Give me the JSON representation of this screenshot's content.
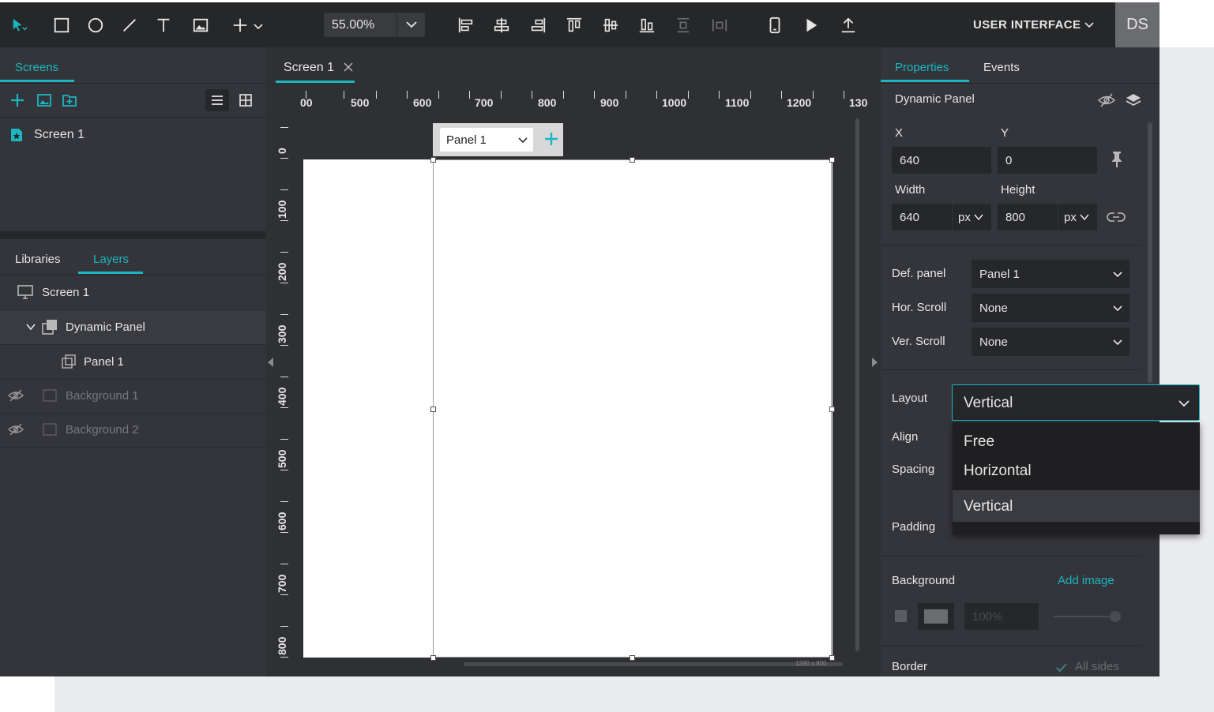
{
  "toolbar": {
    "zoom": "55.00%",
    "project_name": "USER INTERFACE",
    "avatar_initials": "DS"
  },
  "left": {
    "tab_screens": "Screens",
    "screens": [
      {
        "label": "Screen 1"
      }
    ],
    "tab_libraries": "Libraries",
    "tab_layers": "Layers",
    "layers": [
      {
        "label": "Screen 1"
      },
      {
        "label": "Dynamic Panel"
      },
      {
        "label": "Panel 1"
      },
      {
        "label": "Background 1"
      },
      {
        "label": "Background 2"
      }
    ]
  },
  "canvas": {
    "doc_tab": "Screen 1",
    "ruler_top": [
      "00",
      "500",
      "600",
      "700",
      "800",
      "900",
      "1000",
      "1100",
      "1200",
      "130"
    ],
    "ruler_left": [
      "0",
      "100",
      "200",
      "300",
      "400",
      "500",
      "600",
      "700",
      "800"
    ],
    "panel_selector": "Panel 1",
    "size_label": "1280 x 800"
  },
  "properties": {
    "tab_properties": "Properties",
    "tab_events": "Events",
    "section_title": "Dynamic Panel",
    "x_label": "X",
    "y_label": "Y",
    "x_value": "640",
    "y_value": "0",
    "width_label": "Width",
    "height_label": "Height",
    "width_value": "640",
    "height_value": "800",
    "width_unit": "px",
    "height_unit": "px",
    "def_panel_label": "Def. panel",
    "def_panel_value": "Panel 1",
    "hor_scroll_label": "Hor. Scroll",
    "hor_scroll_value": "None",
    "ver_scroll_label": "Ver. Scroll",
    "ver_scroll_value": "None",
    "layout_label": "Layout",
    "layout_value": "Vertical",
    "layout_options": [
      "Free",
      "Horizontal",
      "Vertical"
    ],
    "align_label": "Align",
    "spacing_label": "Spacing",
    "padding_label": "Padding",
    "background_label": "Background",
    "add_image_label": "Add image",
    "opacity_value": "100%",
    "border_label": "Border",
    "all_sides_label": "All sides"
  },
  "colors": {
    "accent": "#1bb6c1",
    "panel_bg": "#34353a",
    "toolbar_bg": "#262729"
  }
}
